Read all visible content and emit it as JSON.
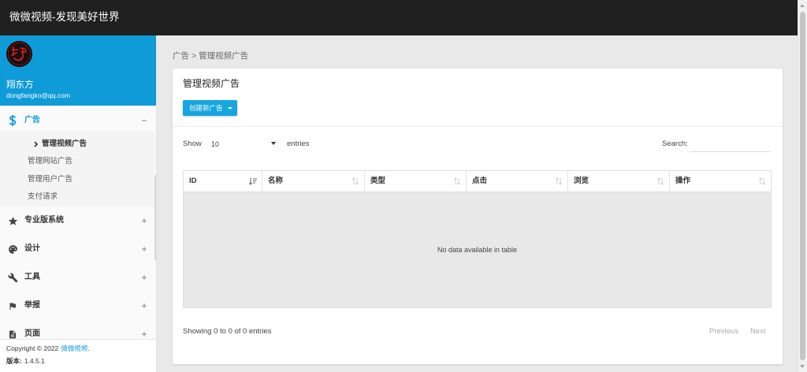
{
  "app": {
    "title": "微微视频-发现美好世界"
  },
  "user": {
    "name": "翔东方",
    "email": "dongfangko@qq.com",
    "avatar_icon": "avatar-logo"
  },
  "sidebar": {
    "menu": [
      {
        "label": "广告",
        "icon": "dollar-icon",
        "toggle": "−",
        "expanded": true,
        "children": [
          "管理视频广告",
          "管理网站广告",
          "管理用户广告",
          "支付请求"
        ],
        "active_child_index": 0
      },
      {
        "label": "专业版系统",
        "icon": "star-icon",
        "toggle": "+"
      },
      {
        "label": "设计",
        "icon": "palette-icon",
        "toggle": "+"
      },
      {
        "label": "工具",
        "icon": "wrench-icon",
        "toggle": "+"
      },
      {
        "label": "举报",
        "icon": "flag-icon",
        "toggle": "+"
      },
      {
        "label": "页面",
        "icon": "file-icon",
        "toggle": "+"
      }
    ],
    "footer": {
      "copyright": "Copyright © 2022",
      "brand_link": "微微视频",
      "suffix": ".",
      "version_label": "版本:",
      "version": "1.4.5.1"
    }
  },
  "breadcrumb": {
    "items": [
      "广告",
      "管理视频广告"
    ],
    "separator": ">"
  },
  "card": {
    "title": "管理视频广告",
    "create_button": "创建新广告",
    "create_button_icon": "caret-down-icon"
  },
  "table_controls": {
    "show_label": "Show",
    "page_size": "10",
    "entries_label": "entries",
    "search_label": "Search:",
    "search_value": ""
  },
  "table": {
    "columns": [
      "ID",
      "名称",
      "类型",
      "点击",
      "浏览",
      "操作"
    ],
    "sorted_column_index": 0,
    "rows": [],
    "empty_message": "No data available in table"
  },
  "pagination": {
    "info": "Showing 0 to 0 of 0 entries",
    "previous": "Previous",
    "next": "Next"
  },
  "colors": {
    "topbar": "#202020",
    "accent": "#0f9bd8",
    "button": "#16a6df",
    "page_background": "#e9e9e9",
    "table_empty_background": "#e8e8e8"
  }
}
